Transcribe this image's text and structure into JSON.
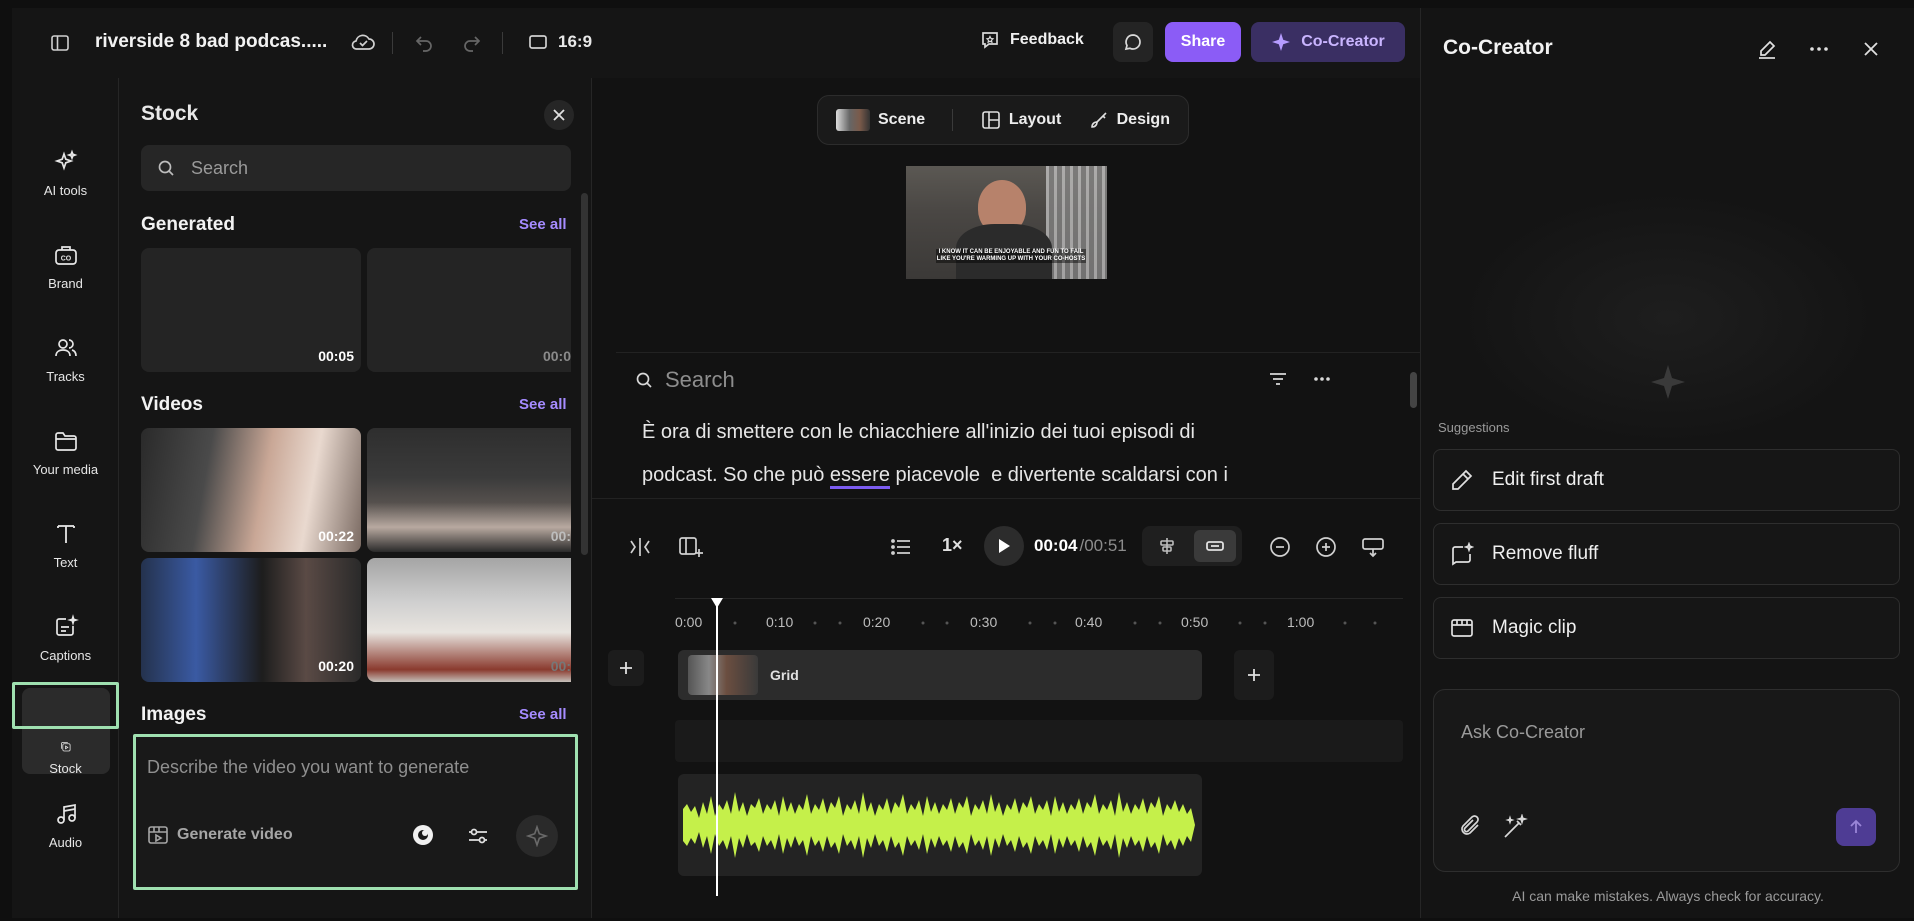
{
  "topbar": {
    "project_title": "riverside 8 bad podcas.....",
    "aspect": "16:9",
    "feedback": "Feedback",
    "share": "Share",
    "co_creator": "Co-Creator"
  },
  "rail": {
    "items": [
      {
        "label": "AI tools",
        "icon": "sparkles-icon"
      },
      {
        "label": "Brand",
        "icon": "brand-kit-icon"
      },
      {
        "label": "Tracks",
        "icon": "people-icon"
      },
      {
        "label": "Your media",
        "icon": "folder-icon"
      },
      {
        "label": "Text",
        "icon": "text-icon"
      },
      {
        "label": "Captions",
        "icon": "captions-icon"
      },
      {
        "label": "Stock",
        "icon": "stock-icon"
      },
      {
        "label": "Audio",
        "icon": "music-icon"
      }
    ],
    "active": "Stock"
  },
  "stock": {
    "title": "Stock",
    "search_placeholder": "Search",
    "generated": {
      "title": "Generated",
      "see_all": "See all",
      "durations": [
        "00:05",
        "00:0"
      ]
    },
    "videos": {
      "title": "Videos",
      "see_all": "See all",
      "durations": [
        "00:22",
        "00:",
        "00:20",
        "00:"
      ]
    },
    "images": {
      "title": "Images",
      "see_all": "See all"
    },
    "generate": {
      "placeholder": "Describe the video you want to generate",
      "label": "Generate video"
    }
  },
  "center": {
    "tabs": [
      "Scene",
      "Layout",
      "Design"
    ],
    "preview_caption": "I KNOW IT CAN BE ENJOYABLE AND FUN TO FAIL LIKE YOU'RE WARMING UP WITH YOUR CO-HOSTS",
    "transcript_search_placeholder": "Search",
    "transcript_line1": "È ora di smettere con le chiacchiere all'inizio dei tuoi episodi di",
    "transcript_line2_a": "podcast. So che può ",
    "transcript_line2_b": "essere",
    "transcript_line2_c": " piacevole  e divertente scaldarsi con i",
    "speed": "1×",
    "time_current": "00:04",
    "time_total": "/00:51",
    "ruler": [
      "0:00",
      "0:10",
      "0:20",
      "0:30",
      "0:40",
      "0:50",
      "1:00"
    ],
    "clip_label": "Grid"
  },
  "right": {
    "title": "Co-Creator",
    "suggestions_label": "Suggestions",
    "suggestions": [
      "Edit first draft",
      "Remove fluff",
      "Magic clip"
    ],
    "ask_placeholder": "Ask Co-Creator",
    "disclaimer": "AI can make mistakes. Always check for accuracy."
  },
  "colors": {
    "accent": "#8b5cf6",
    "highlight_border": "#9fe0b0",
    "waveform": "#c5f04a"
  }
}
